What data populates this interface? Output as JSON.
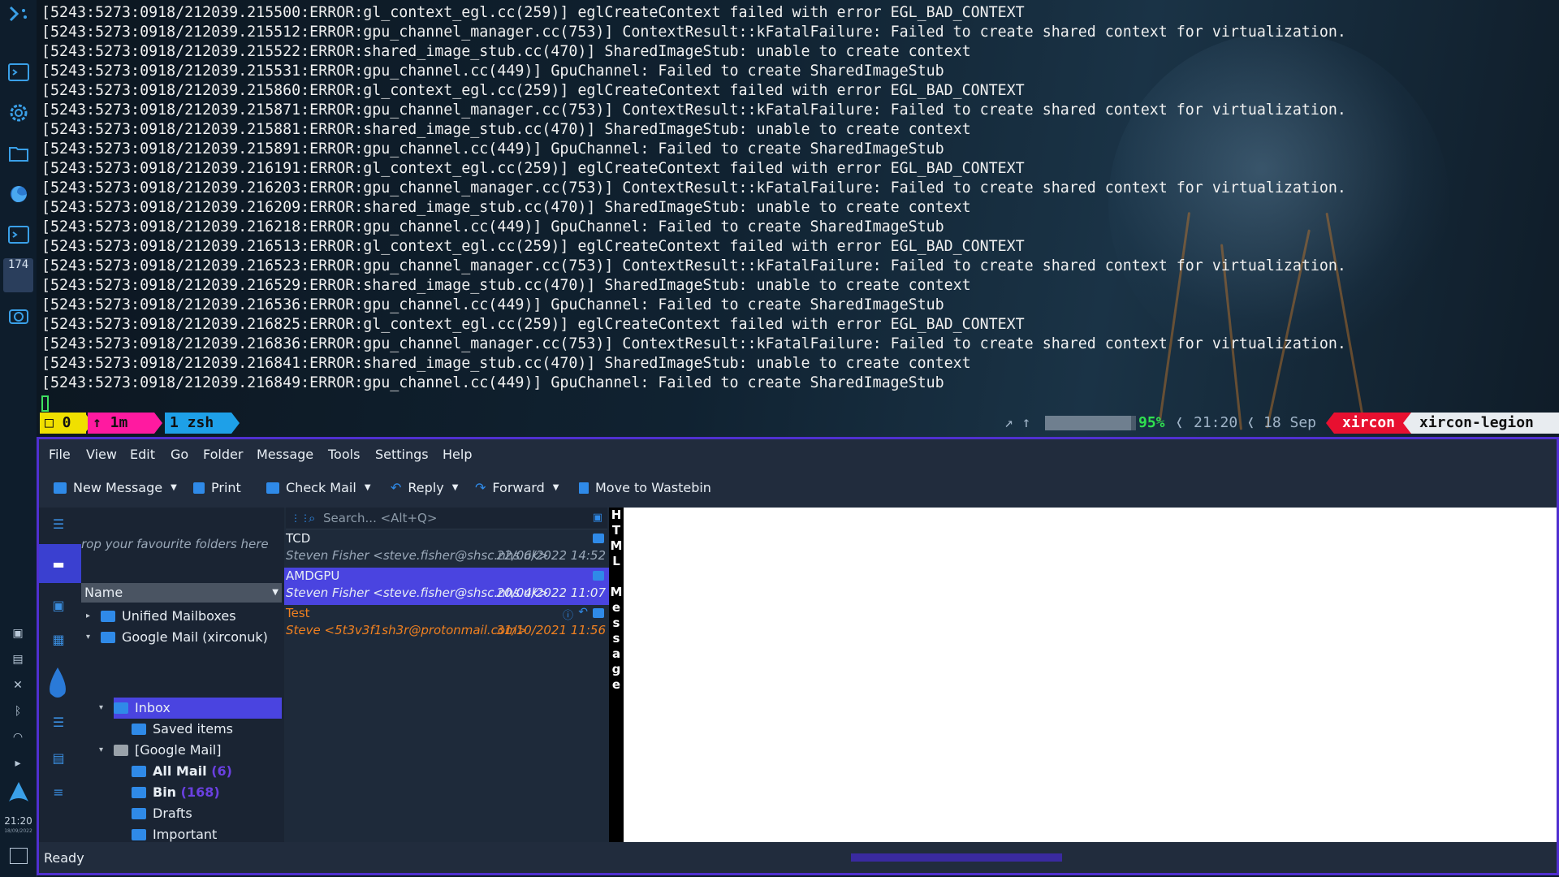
{
  "dock": {
    "items": [
      "kde-dev-icon",
      "terminal-icon",
      "settings-icon",
      "files-icon",
      "firefox-icon",
      "terminal-icon-2",
      "counter-icon",
      "screenshot-icon"
    ],
    "counter": "174",
    "tray": [
      "image-icon",
      "clipboard-icon",
      "mute-icon",
      "bluetooth-icon",
      "wifi-icon",
      "expand-icon",
      "arch-icon"
    ],
    "clock": "21:20",
    "date": "18/09/2022"
  },
  "terminal": {
    "lines": [
      "[5243:5273:0918/212039.215500:ERROR:gl_context_egl.cc(259)] eglCreateContext failed with error EGL_BAD_CONTEXT",
      "[5243:5273:0918/212039.215512:ERROR:gpu_channel_manager.cc(753)] ContextResult::kFatalFailure: Failed to create shared context for virtualization.",
      "[5243:5273:0918/212039.215522:ERROR:shared_image_stub.cc(470)] SharedImageStub: unable to create context",
      "[5243:5273:0918/212039.215531:ERROR:gpu_channel.cc(449)] GpuChannel: Failed to create SharedImageStub",
      "[5243:5273:0918/212039.215860:ERROR:gl_context_egl.cc(259)] eglCreateContext failed with error EGL_BAD_CONTEXT",
      "[5243:5273:0918/212039.215871:ERROR:gpu_channel_manager.cc(753)] ContextResult::kFatalFailure: Failed to create shared context for virtualization.",
      "[5243:5273:0918/212039.215881:ERROR:shared_image_stub.cc(470)] SharedImageStub: unable to create context",
      "[5243:5273:0918/212039.215891:ERROR:gpu_channel.cc(449)] GpuChannel: Failed to create SharedImageStub",
      "[5243:5273:0918/212039.216191:ERROR:gl_context_egl.cc(259)] eglCreateContext failed with error EGL_BAD_CONTEXT",
      "[5243:5273:0918/212039.216203:ERROR:gpu_channel_manager.cc(753)] ContextResult::kFatalFailure: Failed to create shared context for virtualization.",
      "[5243:5273:0918/212039.216209:ERROR:shared_image_stub.cc(470)] SharedImageStub: unable to create context",
      "[5243:5273:0918/212039.216218:ERROR:gpu_channel.cc(449)] GpuChannel: Failed to create SharedImageStub",
      "[5243:5273:0918/212039.216513:ERROR:gl_context_egl.cc(259)] eglCreateContext failed with error EGL_BAD_CONTEXT",
      "[5243:5273:0918/212039.216523:ERROR:gpu_channel_manager.cc(753)] ContextResult::kFatalFailure: Failed to create shared context for virtualization.",
      "[5243:5273:0918/212039.216529:ERROR:shared_image_stub.cc(470)] SharedImageStub: unable to create context",
      "[5243:5273:0918/212039.216536:ERROR:gpu_channel.cc(449)] GpuChannel: Failed to create SharedImageStub",
      "[5243:5273:0918/212039.216825:ERROR:gl_context_egl.cc(259)] eglCreateContext failed with error EGL_BAD_CONTEXT",
      "[5243:5273:0918/212039.216836:ERROR:gpu_channel_manager.cc(753)] ContextResult::kFatalFailure: Failed to create shared context for virtualization.",
      "[5243:5273:0918/212039.216841:ERROR:shared_image_stub.cc(470)] SharedImageStub: unable to create context",
      "[5243:5273:0918/212039.216849:ERROR:gpu_channel.cc(449)] GpuChannel: Failed to create SharedImageStub"
    ]
  },
  "tmux": {
    "window": "□ 0",
    "uptime": "↑ 1m",
    "session": "1 zsh",
    "net_icons": "↗ ↑",
    "battery_fraction": 0.95,
    "battery": "95%",
    "time": "21:20",
    "date": "18 Sep",
    "user": "xircon",
    "host": "xircon-legion",
    "colors": {
      "window": "#f0e000",
      "uptime": "#ff1aa0",
      "session": "#1ea0e8",
      "user": "#e81030",
      "host": "#e8ecf0"
    }
  },
  "mail": {
    "menu": [
      "File",
      "View",
      "Edit",
      "Go",
      "Folder",
      "Message",
      "Tools",
      "Settings",
      "Help"
    ],
    "toolbar": {
      "new_message": "New Message",
      "print": "Print",
      "check_mail": "Check Mail",
      "reply": "Reply",
      "forward": "Forward",
      "wastebin": "Move to Wastebin"
    },
    "favourites_hint": "rop your favourite folders here",
    "folder_header": "Name",
    "folders": [
      {
        "label": "Unified Mailboxes",
        "count": ""
      },
      {
        "label": "Google Mail (xirconuk)",
        "count": ""
      },
      {
        "label": "Inbox",
        "count": ""
      },
      {
        "label": "Saved items",
        "count": ""
      },
      {
        "label": "[Google Mail]",
        "count": ""
      },
      {
        "label": "All Mail",
        "count": "(6)"
      },
      {
        "label": "Bin",
        "count": "(168)"
      },
      {
        "label": "Drafts",
        "count": ""
      },
      {
        "label": "Important",
        "count": ""
      }
    ],
    "search_placeholder": "Search... <Alt+Q>",
    "messages": [
      {
        "subject": "TCD",
        "from": "Steven Fisher <steve.fisher@shsc.nhs.uk>",
        "date": "22/06/2022 14:52"
      },
      {
        "subject": "AMDGPU",
        "from": "Steven Fisher <steve.fisher@shsc.nhs.uk>",
        "date": "20/04/2022 11:07"
      },
      {
        "subject": "Test",
        "from": "Steve <5t3v3f1sh3r@protonmail.com>",
        "date": "31/10/2021 11:56"
      }
    ],
    "banner": [
      "H",
      "T",
      "M",
      "L",
      " ",
      "M",
      "e",
      "s",
      "s",
      "a",
      "g",
      "e"
    ],
    "status": "Ready",
    "accent": "#4a44e0"
  }
}
